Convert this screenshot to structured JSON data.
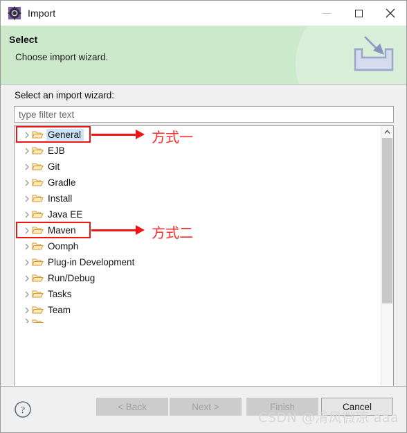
{
  "window": {
    "title": "Import",
    "icon": "eclipse-wizard-icon",
    "controls": {
      "minimize": "minimize-icon",
      "maximize": "maximize-icon",
      "close": "close-icon"
    }
  },
  "banner": {
    "title": "Select",
    "subtitle": "Choose import wizard.",
    "icon": "import-tray-icon",
    "bg_color": "#cce9cb"
  },
  "form": {
    "label": "Select an import wizard:",
    "filter": {
      "value": "",
      "placeholder": "type filter text"
    }
  },
  "tree": {
    "selected": "General",
    "items": [
      {
        "label": "General",
        "expandable": true,
        "selected": true,
        "clipped": false
      },
      {
        "label": "EJB",
        "expandable": true,
        "selected": false,
        "clipped": false
      },
      {
        "label": "Git",
        "expandable": true,
        "selected": false,
        "clipped": false
      },
      {
        "label": "Gradle",
        "expandable": true,
        "selected": false,
        "clipped": false
      },
      {
        "label": "Install",
        "expandable": true,
        "selected": false,
        "clipped": false
      },
      {
        "label": "Java EE",
        "expandable": true,
        "selected": false,
        "clipped": false
      },
      {
        "label": "Maven",
        "expandable": true,
        "selected": false,
        "clipped": false
      },
      {
        "label": "Oomph",
        "expandable": true,
        "selected": false,
        "clipped": false
      },
      {
        "label": "Plug-in Development",
        "expandable": true,
        "selected": false,
        "clipped": false
      },
      {
        "label": "Run/Debug",
        "expandable": true,
        "selected": false,
        "clipped": false
      },
      {
        "label": "Tasks",
        "expandable": true,
        "selected": false,
        "clipped": false
      },
      {
        "label": "Team",
        "expandable": true,
        "selected": false,
        "clipped": false
      },
      {
        "label": "",
        "expandable": true,
        "selected": false,
        "clipped": true
      }
    ],
    "scrollbar": {
      "up_icon": "chevron-up-icon",
      "down_icon": "chevron-down-icon",
      "thumb_position": "top"
    }
  },
  "annotations": {
    "color": "#f01414",
    "items": [
      {
        "target": "General",
        "text": "方式一"
      },
      {
        "target": "Maven",
        "text": "方式二"
      }
    ]
  },
  "buttons": {
    "help": "help-icon",
    "back": {
      "label": "< Back",
      "enabled": false
    },
    "next": {
      "label": "Next >",
      "enabled": false
    },
    "finish": {
      "label": "Finish",
      "enabled": false
    },
    "cancel": {
      "label": "Cancel",
      "enabled": true
    }
  },
  "watermark": {
    "text": "CSDN @清风微凉 aaa"
  }
}
